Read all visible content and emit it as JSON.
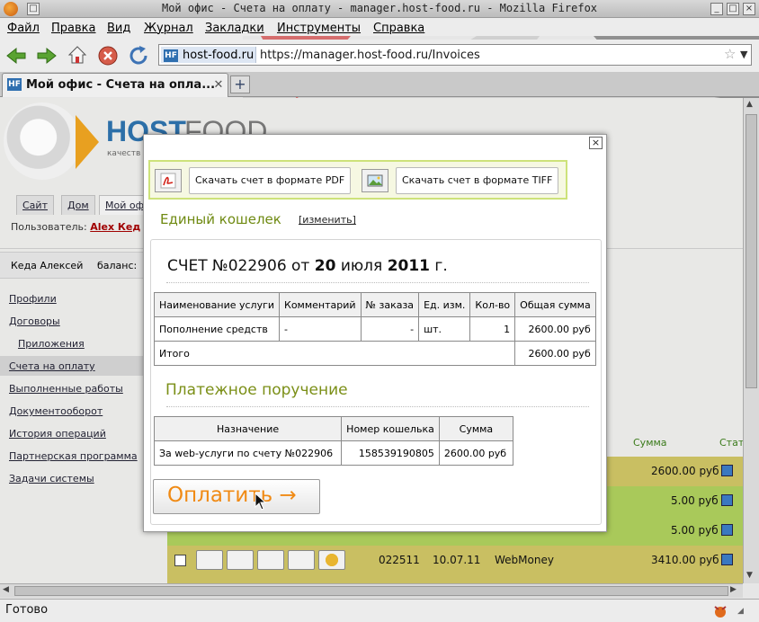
{
  "window": {
    "title": "Мой офис - Счета на оплату - manager.host-food.ru - Mozilla Firefox"
  },
  "menu": [
    "Файл",
    "Правка",
    "Вид",
    "Журнал",
    "Закладки",
    "Инструменты",
    "Справка"
  ],
  "address": {
    "site": "host-food.ru",
    "url": "https://manager.host-food.ru/Invoices",
    "favicon": "HF"
  },
  "tab": {
    "label": "Мой офис - Счета на опла...",
    "new_tab": "+"
  },
  "page": {
    "logo_host": "HOST",
    "logo_food": "FOOD",
    "logo_tag": "качеств",
    "top_tabs": [
      "Сайт",
      "Дом",
      "Мой оф"
    ],
    "user_label": "Пользователь:",
    "user_name": "Alex Кед",
    "user_box_name": "Кеда Алексей",
    "user_box_balance": "баланс: ",
    "sidebar": [
      "Профили",
      "Договоры",
      "Приложения",
      "Счета на оплату",
      "Выполненные работы",
      "Документооборот",
      "История операций",
      "Партнерская программа",
      "Задачи системы"
    ],
    "table_headers": {
      "sum": "Сумма",
      "status": "Стат"
    },
    "rows": [
      {
        "number": "",
        "date": "",
        "method": "",
        "sum": "2600.00 руб",
        "color": "#c9bf62"
      },
      {
        "number": "",
        "date": "",
        "method": "",
        "sum": "5.00 руб",
        "color": "#a9c95a"
      },
      {
        "number": "",
        "date": "",
        "method": "",
        "sum": "5.00 руб",
        "color": "#a9c95a"
      },
      {
        "number": "022511",
        "date": "10.07.11",
        "method": "WebMoney",
        "sum": "3410.00 руб",
        "color": "#c9bf62"
      }
    ]
  },
  "modal": {
    "close": "×",
    "download_pdf": "Скачать счет в формате PDF",
    "download_tiff": "Скачать счет в формате TIFF",
    "wallet_title": "Единый кошелек",
    "wallet_change": "[изменить]",
    "invoice_title_prefix": "СЧЕТ №022906 от",
    "invoice_day": "20",
    "invoice_month": "июля",
    "invoice_year": "2011",
    "invoice_year_suffix": "г.",
    "items_table": {
      "headers": [
        "Наименование услуги",
        "Комментарий",
        "№ заказа",
        "Ед. изм.",
        "Кол-во",
        "Общая сумма"
      ],
      "rows": [
        [
          "Пополнение средств",
          "-",
          "-",
          "шт.",
          "1",
          "2600.00 руб"
        ]
      ],
      "total_label": "Итого",
      "total_value": "2600.00 руб"
    },
    "payment_title": "Платежное поручение",
    "payment_table": {
      "headers": [
        "Назначение",
        "Номер кошелька",
        "Сумма"
      ],
      "rows": [
        [
          "За web-услуги по счету №022906",
          "158539190805",
          "2600.00 руб"
        ]
      ]
    },
    "pay_button": "Оплатить →"
  },
  "status": {
    "text": "Готово"
  },
  "colors": {
    "accent_green": "#7b8f17",
    "pay_orange": "#f08a14",
    "brand_blue": "#2c6fa8"
  }
}
